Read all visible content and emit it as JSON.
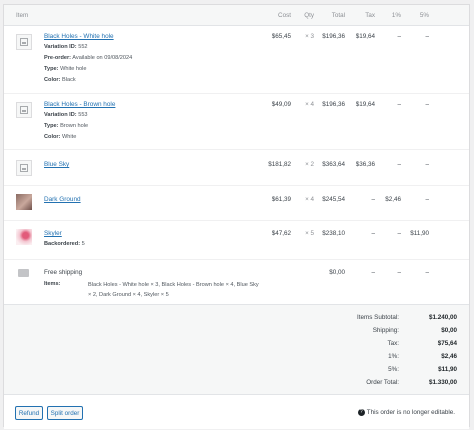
{
  "columns": {
    "item": "Item",
    "cost": "Cost",
    "qty": "Qty",
    "total": "Total",
    "tax": "Tax",
    "p1": "1%",
    "p5": "5%"
  },
  "items": [
    {
      "name": "Black Holes - White hole",
      "meta": [
        {
          "k": "Variation ID:",
          "v": "552"
        },
        {
          "k": "Pre-order:",
          "v": "Available on 09/08/2024"
        },
        {
          "k": "Type:",
          "v": "White hole"
        },
        {
          "k": "Color:",
          "v": "Black"
        }
      ],
      "cost": "$65,45",
      "qty": "× 3",
      "total": "$196,36",
      "tax": "$19,64",
      "p1": "–",
      "p5": "–"
    },
    {
      "name": "Black Holes - Brown hole",
      "meta": [
        {
          "k": "Variation ID:",
          "v": "553"
        },
        {
          "k": "Type:",
          "v": "Brown hole"
        },
        {
          "k": "Color:",
          "v": "White"
        }
      ],
      "cost": "$49,09",
      "qty": "× 4",
      "total": "$196,36",
      "tax": "$19,64",
      "p1": "–",
      "p5": "–"
    },
    {
      "name": "Blue Sky",
      "meta": [],
      "cost": "$181,82",
      "qty": "× 2",
      "total": "$363,64",
      "tax": "$36,36",
      "p1": "–",
      "p5": "–"
    },
    {
      "name": "Dark Ground",
      "meta": [],
      "cost": "$61,39",
      "qty": "× 4",
      "total": "$245,54",
      "tax": "–",
      "p1": "$2,46",
      "p5": "–"
    },
    {
      "name": "Skyler",
      "meta": [
        {
          "k": "Backordered:",
          "v": "5"
        }
      ],
      "cost": "$47,62",
      "qty": "× 5",
      "total": "$238,10",
      "tax": "–",
      "p1": "–",
      "p5": "$11,90"
    }
  ],
  "shipping": {
    "name": "Free shipping",
    "items_label": "Items:",
    "items_value": "Black Holes - White hole × 3, Black Holes - Brown hole × 4, Blue Sky × 2, Dark Ground × 4, Skyler × 5",
    "total": "$0,00",
    "tax": "–",
    "p1": "–",
    "p5": "–"
  },
  "totals": [
    {
      "label": "Items Subtotal:",
      "value": "$1.240,00"
    },
    {
      "label": "Shipping:",
      "value": "$0,00"
    },
    {
      "label": "Tax:",
      "value": "$75,64"
    },
    {
      "label": "1%:",
      "value": "$2,46"
    },
    {
      "label": "5%:",
      "value": "$11,90"
    },
    {
      "label": "Order Total:",
      "value": "$1.330,00"
    }
  ],
  "actions": {
    "refund": "Refund",
    "split": "Split order",
    "note": "This order is no longer editable.",
    "note_icon": "?"
  }
}
